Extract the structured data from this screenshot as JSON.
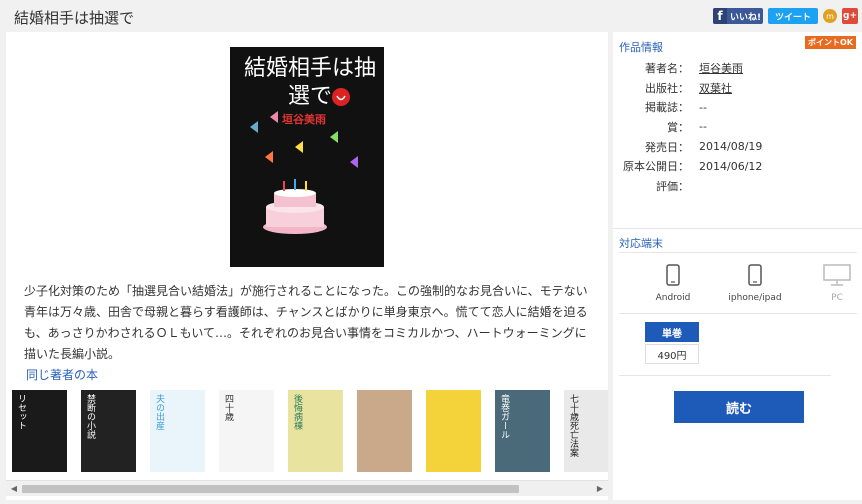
{
  "page": {
    "title": "結婚相手は抽選で"
  },
  "social": {
    "facebook_label": "いいね!",
    "tweet_label": "ツイート",
    "mixi_label": "m",
    "gplus_label": "g+"
  },
  "cover": {
    "title": "結婚相手は抽選で",
    "author": "垣谷美雨"
  },
  "description": "少子化対策のため「抽選見合い結婚法」が施行されることになった。この強制的なお見合いに、モテない青年は万々歳、田舎で母親と暮らす看護師は、チャンスとばかりに単身東京へ。慌てて恋人に結婚を迫るも、あっさりかわされるＯＬもいて…。それぞれのお見合い事情をコミカルかつ、ハートウォーミングに描いた長編小説。",
  "same_author": {
    "heading": "同じ著者の本",
    "books": [
      {
        "title": "リセット",
        "color": "#1a1a1a",
        "text": "#fff"
      },
      {
        "title": "禁断の小説",
        "color": "#222",
        "text": "#fff"
      },
      {
        "title": "夫の出産",
        "color": "#eaf4fb",
        "text": "#3aa0d8"
      },
      {
        "title": "四十歳",
        "color": "#f5f5f5",
        "text": "#333"
      },
      {
        "title": "後悔病棟",
        "color": "#e8e4a0",
        "text": "#2a7a5a"
      },
      {
        "title": "",
        "color": "#c9a98a",
        "text": "#333"
      },
      {
        "title": "",
        "color": "#f3d23a",
        "text": "#333"
      },
      {
        "title": "竜巻ガール",
        "color": "#4a6a7a",
        "text": "#fff"
      },
      {
        "title": "七十歳死亡法案",
        "color": "#e9e9e9",
        "text": "#222"
      },
      {
        "title": "",
        "color": "#f0c020",
        "text": "#c02020"
      }
    ]
  },
  "sidebar": {
    "info_heading": "作品情報",
    "point_badge": "ポイントOK",
    "fields": [
      {
        "key": "著者名：",
        "value": "垣谷美雨",
        "link": true
      },
      {
        "key": "出版社：",
        "value": "双葉社",
        "link": true
      },
      {
        "key": "掲載誌：",
        "value": "--",
        "link": false
      },
      {
        "key": "賞：",
        "value": "--",
        "link": false
      },
      {
        "key": "発売日：",
        "value": "2014/08/19",
        "link": false
      },
      {
        "key": "原本公開日：",
        "value": "2014/06/12",
        "link": false
      },
      {
        "key": "評価：",
        "value": "",
        "link": false
      }
    ],
    "devices_heading": "対応端末",
    "devices": [
      {
        "label": "Android",
        "available": true
      },
      {
        "label": "iphone/ipad",
        "available": true
      },
      {
        "label": "PC",
        "available": false
      }
    ],
    "volume_label": "単巻",
    "price": "490円",
    "read_button": "読む"
  }
}
